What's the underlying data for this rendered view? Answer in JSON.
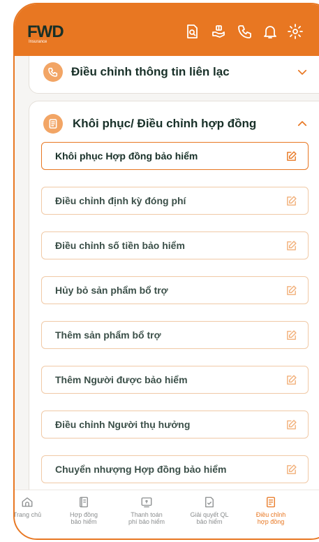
{
  "header": {
    "logo_text": "FWD",
    "logo_sub": "Insurance",
    "icons": [
      "document-search-icon",
      "hand-gift-icon",
      "phone-icon",
      "bell-icon",
      "settings-icon"
    ]
  },
  "sections": {
    "contact": {
      "title": "Điều chỉnh thông tin liên lạc",
      "icon": "phone-icon",
      "expanded": false
    },
    "restore": {
      "title": "Khôi phục/ Điều chỉnh hợp đồng",
      "icon": "document-icon",
      "expanded": true,
      "items": [
        {
          "label": "Khôi phục Hợp đồng bảo hiểm",
          "active": true
        },
        {
          "label": "Điều chỉnh định kỳ đóng phí",
          "active": false
        },
        {
          "label": "Điều chỉnh số tiền bảo hiểm",
          "active": false
        },
        {
          "label": "Hủy bỏ sản phẩm bổ trợ",
          "active": false
        },
        {
          "label": "Thêm sản phẩm bổ trợ",
          "active": false
        },
        {
          "label": "Thêm Người được bảo hiểm",
          "active": false
        },
        {
          "label": "Điều chỉnh Người thụ hưởng",
          "active": false
        },
        {
          "label": "Chuyển nhượng Hợp đồng bảo hiểm",
          "active": false
        }
      ]
    }
  },
  "bottom_nav": {
    "items": [
      {
        "label": "Trang chủ",
        "icon": "home-icon",
        "active": false
      },
      {
        "label": "Hợp đồng\nbảo hiểm",
        "icon": "contract-icon",
        "active": false
      },
      {
        "label": "Thanh toán\nphí bảo hiểm",
        "icon": "payment-icon",
        "active": false
      },
      {
        "label": "Giải quyết QL\nbảo hiểm",
        "icon": "claim-icon",
        "active": false
      },
      {
        "label": "Điều chỉnh\nhợp đồng",
        "icon": "adjust-contract-icon",
        "active": true
      }
    ]
  },
  "colors": {
    "brand_orange": "#E87722",
    "brand_green": "#183028",
    "muted_text": "#8B8E8F"
  }
}
